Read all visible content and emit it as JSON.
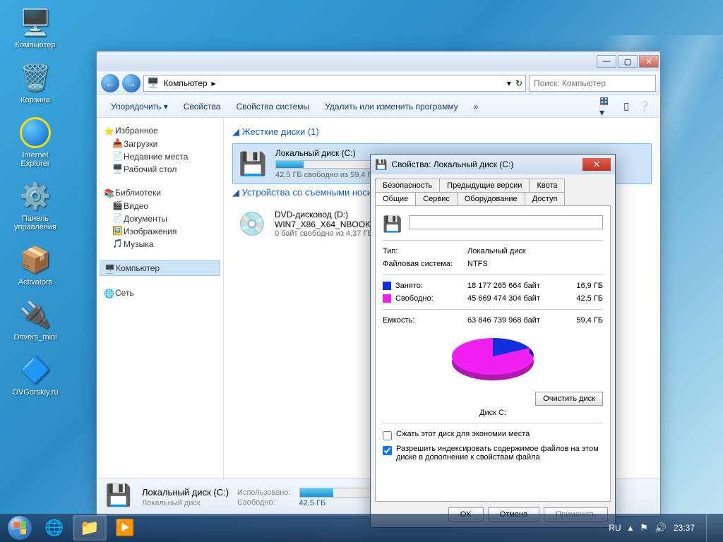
{
  "desktop": {
    "icons": [
      {
        "cls": "comp",
        "label": "Компьютер"
      },
      {
        "cls": "bin",
        "label": "Корзина"
      },
      {
        "cls": "ie",
        "label": "Internet Explorer"
      },
      {
        "cls": "cpanel",
        "label": "Панель управления"
      },
      {
        "cls": "act",
        "label": "Activators"
      },
      {
        "cls": "drv",
        "label": "Drivers_mini"
      },
      {
        "cls": "ovg",
        "label": "OVGorskiy.ru"
      }
    ]
  },
  "explorer": {
    "breadcrumb": "Компьютер",
    "searchPlaceholder": "Поиск: Компьютер",
    "commands": [
      "Упорядочить",
      "Свойства",
      "Свойства системы",
      "Удалить или изменить программу"
    ],
    "nav": {
      "favorites": {
        "header": "Избранное",
        "items": [
          "Загрузки",
          "Недавние места",
          "Рабочий стол"
        ]
      },
      "libraries": {
        "header": "Библиотеки",
        "items": [
          "Видео",
          "Документы",
          "Изображения",
          "Музыка"
        ]
      },
      "computer": "Компьютер",
      "network": "Сеть"
    },
    "sections": {
      "hdd": {
        "title": "Жесткие диски (1)",
        "item": {
          "name": "Локальный диск (C:)",
          "sub": "42,5 ГБ свободно из 59,4 ГБ",
          "pct": 28
        }
      },
      "rem": {
        "title": "Устройства со съемными носителями",
        "item": {
          "name": "DVD-дисковод (D:)",
          "name2": "WIN7_X86_X64_NBOOK",
          "sub": "0 байт свободно из 4,37 ГБ"
        }
      }
    },
    "details": {
      "name": "Локальный диск (C:)",
      "type": "Локальный диск",
      "usedLabel": "Использовано:",
      "freeLabel": "Свободно:",
      "freeVal": "42,5 ГБ",
      "pct": 28
    }
  },
  "props": {
    "title": "Свойства: Локальный диск (C:)",
    "tabs": {
      "row1": [
        "Безопасность",
        "Предыдущие версии",
        "Квота"
      ],
      "row2": [
        "Общие",
        "Сервис",
        "Оборудование",
        "Доступ"
      ],
      "active": "Общие"
    },
    "nameValue": "",
    "typeLabel": "Тип:",
    "typeVal": "Локальный диск",
    "fsLabel": "Файловая система:",
    "fsVal": "NTFS",
    "usedLabel": "Занято:",
    "usedBytes": "18 177 265 664 байт",
    "usedGB": "16,9 ГБ",
    "freeLabel": "Свободно:",
    "freeBytes": "45 669 474 304 байт",
    "freeGB": "42,5 ГБ",
    "capLabel": "Емкость:",
    "capBytes": "63 846 739 968 байт",
    "capGB": "59,4 ГБ",
    "clean": "Очистить диск",
    "diskCaption": "Диск C:",
    "compress": "Сжать этот диск для экономии места",
    "index": "Разрешить индексировать содержимое файлов на этом диске в дополнение к свойствам файла",
    "ok": "OK",
    "cancel": "Отмена",
    "apply": "Применить"
  },
  "chart_data": {
    "type": "pie",
    "title": "Диск C:",
    "series": [
      {
        "name": "Занято",
        "value": 18177265664,
        "gb": 16.9,
        "color": "#1030e0"
      },
      {
        "name": "Свободно",
        "value": 45669474304,
        "gb": 42.5,
        "color": "#f020f0"
      }
    ],
    "total": 63846739968
  },
  "taskbar": {
    "lang": "RU",
    "time": "23:37"
  }
}
